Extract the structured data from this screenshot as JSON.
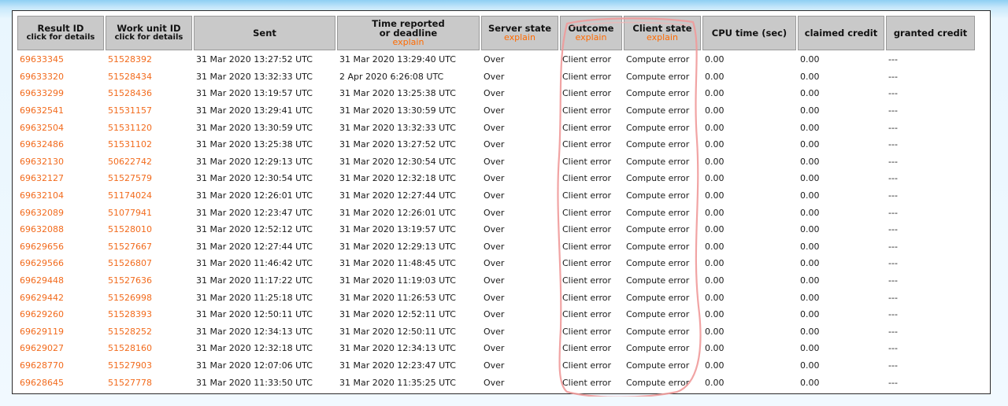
{
  "headers": {
    "result_id": "Result ID",
    "result_id_sub": "click for details",
    "workunit_id": "Work unit ID",
    "workunit_id_sub": "click for details",
    "sent": "Sent",
    "time_reported_1": "Time reported",
    "time_reported_2": "or deadline",
    "time_reported_explain": "explain",
    "server_state": "Server state",
    "server_state_explain": "explain",
    "outcome": "Outcome",
    "outcome_explain": "explain",
    "client_state": "Client state",
    "client_state_explain": "explain",
    "cpu_time": "CPU time (sec)",
    "claimed_credit": "claimed credit",
    "granted_credit": "granted credit"
  },
  "rows": [
    {
      "result_id": "69633345",
      "workunit_id": "51528392",
      "sent": "31 Mar 2020 13:27:52 UTC",
      "reported": "31 Mar 2020 13:29:40 UTC",
      "server_state": "Over",
      "outcome": "Client error",
      "client_state": "Compute error",
      "cpu": "0.00",
      "claimed": "0.00",
      "granted": "---"
    },
    {
      "result_id": "69633320",
      "workunit_id": "51528434",
      "sent": "31 Mar 2020 13:32:33 UTC",
      "reported": "2 Apr 2020 6:26:08 UTC",
      "server_state": "Over",
      "outcome": "Client error",
      "client_state": "Compute error",
      "cpu": "0.00",
      "claimed": "0.00",
      "granted": "---"
    },
    {
      "result_id": "69633299",
      "workunit_id": "51528436",
      "sent": "31 Mar 2020 13:19:57 UTC",
      "reported": "31 Mar 2020 13:25:38 UTC",
      "server_state": "Over",
      "outcome": "Client error",
      "client_state": "Compute error",
      "cpu": "0.00",
      "claimed": "0.00",
      "granted": "---"
    },
    {
      "result_id": "69632541",
      "workunit_id": "51531157",
      "sent": "31 Mar 2020 13:29:41 UTC",
      "reported": "31 Mar 2020 13:30:59 UTC",
      "server_state": "Over",
      "outcome": "Client error",
      "client_state": "Compute error",
      "cpu": "0.00",
      "claimed": "0.00",
      "granted": "---"
    },
    {
      "result_id": "69632504",
      "workunit_id": "51531120",
      "sent": "31 Mar 2020 13:30:59 UTC",
      "reported": "31 Mar 2020 13:32:33 UTC",
      "server_state": "Over",
      "outcome": "Client error",
      "client_state": "Compute error",
      "cpu": "0.00",
      "claimed": "0.00",
      "granted": "---"
    },
    {
      "result_id": "69632486",
      "workunit_id": "51531102",
      "sent": "31 Mar 2020 13:25:38 UTC",
      "reported": "31 Mar 2020 13:27:52 UTC",
      "server_state": "Over",
      "outcome": "Client error",
      "client_state": "Compute error",
      "cpu": "0.00",
      "claimed": "0.00",
      "granted": "---"
    },
    {
      "result_id": "69632130",
      "workunit_id": "50622742",
      "sent": "31 Mar 2020 12:29:13 UTC",
      "reported": "31 Mar 2020 12:30:54 UTC",
      "server_state": "Over",
      "outcome": "Client error",
      "client_state": "Compute error",
      "cpu": "0.00",
      "claimed": "0.00",
      "granted": "---"
    },
    {
      "result_id": "69632127",
      "workunit_id": "51527579",
      "sent": "31 Mar 2020 12:30:54 UTC",
      "reported": "31 Mar 2020 12:32:18 UTC",
      "server_state": "Over",
      "outcome": "Client error",
      "client_state": "Compute error",
      "cpu": "0.00",
      "claimed": "0.00",
      "granted": "---"
    },
    {
      "result_id": "69632104",
      "workunit_id": "51174024",
      "sent": "31 Mar 2020 12:26:01 UTC",
      "reported": "31 Mar 2020 12:27:44 UTC",
      "server_state": "Over",
      "outcome": "Client error",
      "client_state": "Compute error",
      "cpu": "0.00",
      "claimed": "0.00",
      "granted": "---"
    },
    {
      "result_id": "69632089",
      "workunit_id": "51077941",
      "sent": "31 Mar 2020 12:23:47 UTC",
      "reported": "31 Mar 2020 12:26:01 UTC",
      "server_state": "Over",
      "outcome": "Client error",
      "client_state": "Compute error",
      "cpu": "0.00",
      "claimed": "0.00",
      "granted": "---"
    },
    {
      "result_id": "69632088",
      "workunit_id": "51528010",
      "sent": "31 Mar 2020 12:52:12 UTC",
      "reported": "31 Mar 2020 13:19:57 UTC",
      "server_state": "Over",
      "outcome": "Client error",
      "client_state": "Compute error",
      "cpu": "0.00",
      "claimed": "0.00",
      "granted": "---"
    },
    {
      "result_id": "69629656",
      "workunit_id": "51527667",
      "sent": "31 Mar 2020 12:27:44 UTC",
      "reported": "31 Mar 2020 12:29:13 UTC",
      "server_state": "Over",
      "outcome": "Client error",
      "client_state": "Compute error",
      "cpu": "0.00",
      "claimed": "0.00",
      "granted": "---"
    },
    {
      "result_id": "69629566",
      "workunit_id": "51526807",
      "sent": "31 Mar 2020 11:46:42 UTC",
      "reported": "31 Mar 2020 11:48:45 UTC",
      "server_state": "Over",
      "outcome": "Client error",
      "client_state": "Compute error",
      "cpu": "0.00",
      "claimed": "0.00",
      "granted": "---"
    },
    {
      "result_id": "69629448",
      "workunit_id": "51527636",
      "sent": "31 Mar 2020 11:17:22 UTC",
      "reported": "31 Mar 2020 11:19:03 UTC",
      "server_state": "Over",
      "outcome": "Client error",
      "client_state": "Compute error",
      "cpu": "0.00",
      "claimed": "0.00",
      "granted": "---"
    },
    {
      "result_id": "69629442",
      "workunit_id": "51526998",
      "sent": "31 Mar 2020 11:25:18 UTC",
      "reported": "31 Mar 2020 11:26:53 UTC",
      "server_state": "Over",
      "outcome": "Client error",
      "client_state": "Compute error",
      "cpu": "0.00",
      "claimed": "0.00",
      "granted": "---"
    },
    {
      "result_id": "69629260",
      "workunit_id": "51528393",
      "sent": "31 Mar 2020 12:50:11 UTC",
      "reported": "31 Mar 2020 12:52:11 UTC",
      "server_state": "Over",
      "outcome": "Client error",
      "client_state": "Compute error",
      "cpu": "0.00",
      "claimed": "0.00",
      "granted": "---"
    },
    {
      "result_id": "69629119",
      "workunit_id": "51528252",
      "sent": "31 Mar 2020 12:34:13 UTC",
      "reported": "31 Mar 2020 12:50:11 UTC",
      "server_state": "Over",
      "outcome": "Client error",
      "client_state": "Compute error",
      "cpu": "0.00",
      "claimed": "0.00",
      "granted": "---"
    },
    {
      "result_id": "69629027",
      "workunit_id": "51528160",
      "sent": "31 Mar 2020 12:32:18 UTC",
      "reported": "31 Mar 2020 12:34:13 UTC",
      "server_state": "Over",
      "outcome": "Client error",
      "client_state": "Compute error",
      "cpu": "0.00",
      "claimed": "0.00",
      "granted": "---"
    },
    {
      "result_id": "69628770",
      "workunit_id": "51527903",
      "sent": "31 Mar 2020 12:07:06 UTC",
      "reported": "31 Mar 2020 12:23:47 UTC",
      "server_state": "Over",
      "outcome": "Client error",
      "client_state": "Compute error",
      "cpu": "0.00",
      "claimed": "0.00",
      "granted": "---"
    },
    {
      "result_id": "69628645",
      "workunit_id": "51527778",
      "sent": "31 Mar 2020 11:33:50 UTC",
      "reported": "31 Mar 2020 11:35:25 UTC",
      "server_state": "Over",
      "outcome": "Client error",
      "client_state": "Compute error",
      "cpu": "0.00",
      "claimed": "0.00",
      "granted": "---"
    }
  ],
  "colors": {
    "link": "#f26b1d",
    "header_bg": "#c9c9c9",
    "annotation": "#ef9a9a"
  }
}
